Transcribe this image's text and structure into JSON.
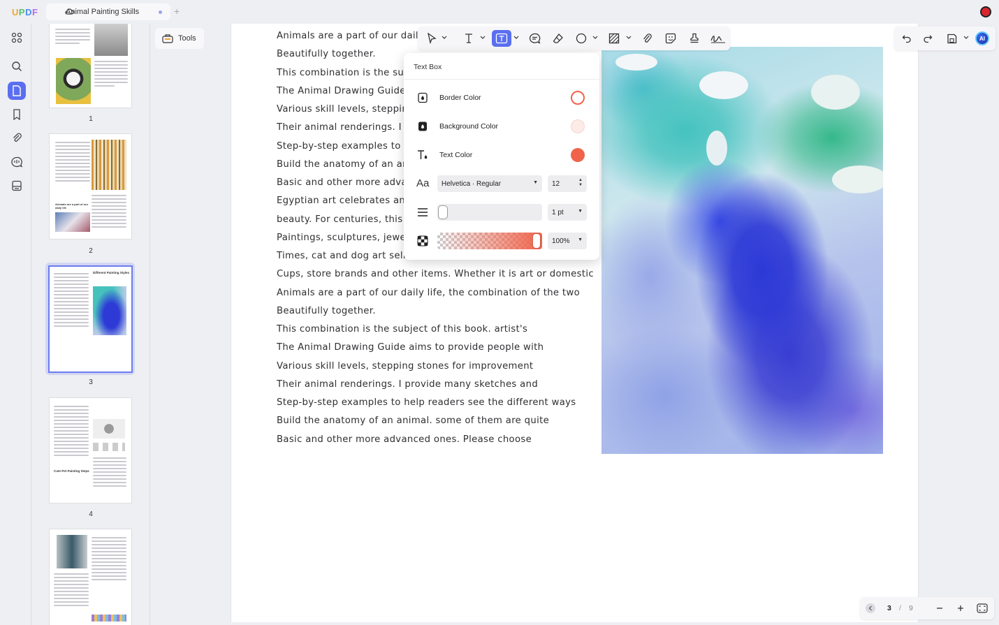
{
  "app": {
    "brand": "UPDF",
    "tab_title": "Animal Painting Skills",
    "new_tab_symbol": "+"
  },
  "rail": {
    "items": [
      "apps-icon",
      "search-icon",
      "pages-icon",
      "bookmark-icon",
      "attachment-icon",
      "comments-icon",
      "form-icon"
    ],
    "active": "pages-icon"
  },
  "thumbnails": {
    "pages": [
      "1",
      "2",
      "3",
      "4"
    ],
    "selected": "3",
    "thumb_titles": {
      "p2": "Animals are a part of our daily life",
      "p3": "Different Painting Styles",
      "p4": "Cute Pet Painting Steps"
    }
  },
  "tools_chip": {
    "label": "Tools"
  },
  "document": {
    "lines": [
      "Animals are a part of our daily lif",
      "Beautifully together.",
      "This combination is the subje",
      "The Animal Drawing Guide ain",
      "Various skill levels, stepping s",
      "Their animal renderings. I pro",
      "Step-by-step examples to help",
      "Build the anatomy of an anim",
      "Basic and other more advanc",
      "Egyptian art celebrates anima",
      "beauty. For centuries, this hor",
      "Paintings, sculptures, jewelry",
      "Times, cat and dog art sells a",
      "Cups, store brands and other items. Whether it is art or domestic",
      "Animals are a part of our daily life, the combination of the two",
      "Beautifully together.",
      "This combination is the subject of this book. artist's",
      "The Animal Drawing Guide aims to provide people with",
      "Various skill levels, stepping stones for improvement",
      "Their animal renderings. I provide many sketches and",
      "Step-by-step examples to help readers see the different ways",
      "Build the anatomy of an animal. some of them are quite",
      "Basic and other more advanced ones. Please choose"
    ]
  },
  "annotation_toolbar": {
    "active_tool": "text-box-tool"
  },
  "right_toolbar": {
    "ai_label": "AI"
  },
  "text_box_popover": {
    "title": "Text Box",
    "border_color_label": "Border Color",
    "background_color_label": "Background Color",
    "text_color_label": "Text Color",
    "border_color": "#f0634a",
    "background_color": "#fcebe7",
    "text_color": "#f0634a",
    "font_family": "Helvetica · Regular",
    "font_size": "12",
    "border_width": "1 pt",
    "opacity": "100%",
    "opacity_level": 1.0
  },
  "pager": {
    "current": "3",
    "separator": "/",
    "total": "9"
  }
}
